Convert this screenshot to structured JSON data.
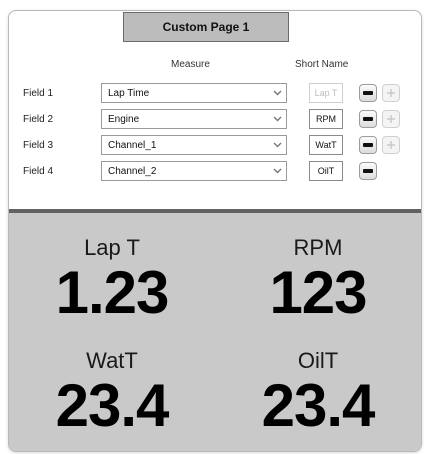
{
  "title": "Custom Page 1",
  "columns": {
    "measure": "Measure",
    "short_name": "Short Name"
  },
  "fields": [
    {
      "label": "Field 1",
      "measure": "Lap Time",
      "short_name": "Lap T",
      "short_disabled": true
    },
    {
      "label": "Field 2",
      "measure": "Engine",
      "short_name": "RPM",
      "short_disabled": false
    },
    {
      "label": "Field 3",
      "measure": "Channel_1",
      "short_name": "WatT",
      "short_disabled": false
    },
    {
      "label": "Field 4",
      "measure": "Channel_2",
      "short_name": "OilT",
      "short_disabled": false
    }
  ],
  "display": [
    {
      "label": "Lap T",
      "value": "1.23"
    },
    {
      "label": "RPM",
      "value": "123"
    },
    {
      "label": "WatT",
      "value": "23.4"
    },
    {
      "label": "OilT",
      "value": "23.4"
    }
  ],
  "icons": {
    "dropdown": "chevron-down-icon",
    "remove": "minus-icon",
    "add": "plus-icon"
  },
  "colors": {
    "title_bg": "#bcbcbc",
    "display_bg": "#c9c9c9",
    "display_border": "#616161"
  }
}
